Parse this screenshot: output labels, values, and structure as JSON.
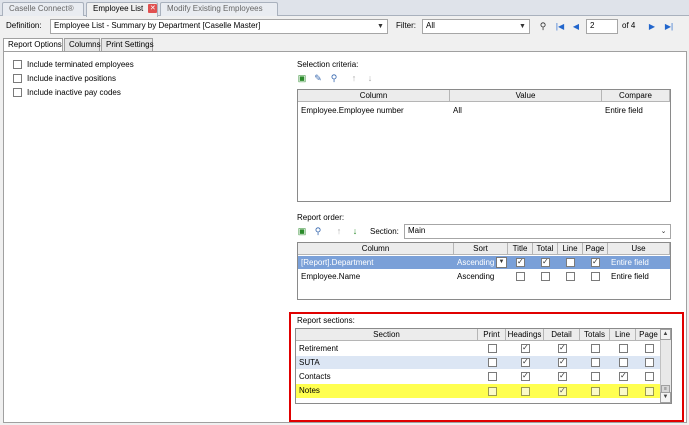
{
  "tabs": [
    {
      "label": "Caselle Connect®",
      "active": false
    },
    {
      "label": "Employee List",
      "active": true,
      "closable": true
    },
    {
      "label": "Modify Existing Employees",
      "active": false
    }
  ],
  "toolbar": {
    "definition_label": "Definition:",
    "definition_value": "Employee List - Summary by Department [Caselle Master]",
    "filter_label": "Filter:",
    "filter_value": "All",
    "page_current": "2",
    "page_total": "of 4"
  },
  "report_tabs": [
    {
      "label": "Report Options",
      "active": true
    },
    {
      "label": "Columns",
      "active": false
    },
    {
      "label": "Print Settings",
      "active": false
    }
  ],
  "options": [
    {
      "label": "Include terminated employees",
      "checked": false
    },
    {
      "label": "Include inactive positions",
      "checked": false
    },
    {
      "label": "Include inactive pay codes",
      "checked": false
    }
  ],
  "selection": {
    "title": "Selection criteria:",
    "headers": [
      "Column",
      "Value",
      "Compare"
    ],
    "rows": [
      {
        "column": "Employee.Employee number",
        "value": "All",
        "compare": "Entire field"
      }
    ]
  },
  "order": {
    "title": "Report order:",
    "section_label": "Section:",
    "section_value": "Main",
    "headers": [
      "Column",
      "Sort",
      "Title",
      "Total",
      "Line",
      "Page",
      "Use"
    ],
    "rows": [
      {
        "column": "[Report].Department",
        "sort": "Ascending",
        "title": true,
        "total": true,
        "line": false,
        "page": true,
        "use": "Entire field",
        "selected": true
      },
      {
        "column": "Employee.Name",
        "sort": "Ascending",
        "title": false,
        "total": false,
        "line": false,
        "page": false,
        "use": "Entire field",
        "selected": false
      }
    ]
  },
  "sections": {
    "title": "Report sections:",
    "headers": [
      "Section",
      "Print",
      "Headings",
      "Detail",
      "Totals",
      "Line",
      "Page"
    ],
    "rows": [
      {
        "name": "Retirement",
        "print": false,
        "headings": true,
        "detail": true,
        "totals": false,
        "line": false,
        "page": false
      },
      {
        "name": "SUTA",
        "print": false,
        "headings": true,
        "detail": true,
        "totals": false,
        "line": false,
        "page": false
      },
      {
        "name": "Contacts",
        "print": false,
        "headings": true,
        "detail": true,
        "totals": false,
        "line": true,
        "page": false
      },
      {
        "name": "Notes",
        "print": false,
        "headings": false,
        "detail": true,
        "totals": false,
        "line": false,
        "page": false
      }
    ]
  },
  "colors": {
    "highlight": "#ffff50",
    "selected_row": "#7aa0d8",
    "annotation": "#e00000"
  }
}
